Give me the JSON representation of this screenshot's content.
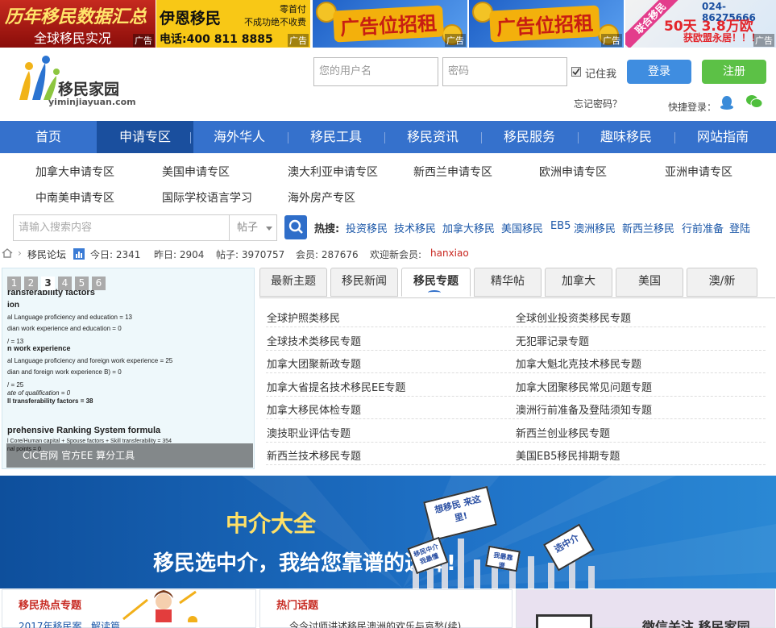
{
  "ads": [
    {
      "line1": "历年移民数据汇总",
      "line2": "全球移民实况",
      "tag": "广告"
    },
    {
      "line1": "伊恩移民",
      "line2": "零首付",
      "line3": "不成功绝不收费",
      "line4": "电话:400 811 8885",
      "tag": "广告"
    },
    {
      "line1": "广告位招租",
      "tag": "广告"
    },
    {
      "line1": "广告位招租",
      "tag": "广告"
    },
    {
      "ribbon": "联合移民",
      "line1": "024-86275666",
      "line2": "50天 3.8万欧",
      "line3": "获欧盟永居！！！",
      "tag": "广告"
    }
  ],
  "logo": {
    "name": "移民家园",
    "domain": "yiminjiayuan.com"
  },
  "login": {
    "username_placeholder": "您的用户名",
    "password_placeholder": "密码",
    "remember_label": "记住我",
    "login_button": "登录",
    "register_button": "注册",
    "forgot_link": "忘记密码？",
    "quick_login_label": "快捷登录："
  },
  "nav": [
    "首页",
    "申请专区",
    "海外华人",
    "移民工具",
    "移民资讯",
    "移民服务",
    "趣味移民",
    "网站指南"
  ],
  "subnav": [
    "加拿大申请专区",
    "美国申请专区",
    "澳大利亚申请专区",
    "新西兰申请专区",
    "欧洲申请专区",
    "亚洲申请专区",
    "中南美申请专区",
    "国际学校语言学习",
    "海外房产专区"
  ],
  "search": {
    "placeholder": "请输入搜索内容",
    "type": "帖子",
    "hot_label": "热搜:",
    "hot_links": [
      "投资移民",
      "技术移民",
      "加拿大移民",
      "美国移民",
      "EB5",
      "澳洲移民",
      "新西兰移民",
      "行前准备",
      "登陆"
    ]
  },
  "stats": {
    "forum": "移民论坛",
    "today": "今日: 2341",
    "yesterday": "昨日: 2904",
    "posts": "帖子: 3970757",
    "members": "会员: 287676",
    "welcome": "欢迎新会员:",
    "new_member": "hanxiao"
  },
  "carousel": {
    "pages": [
      "1",
      "2",
      "3",
      "4",
      "5",
      "6"
    ],
    "active_page": 3,
    "caption": "CIC官网 官方EE 算分工具",
    "lines": [
      "ransferability factors",
      "ion",
      "al Language proficiency and education = 13",
      "dian work experience and education = 0",
      "/ = 13",
      "n work experience",
      "al Language proficiency and foreign work experience = 25",
      "dian and foreign work experience B) = 0",
      "/ = 25",
      "ate of qualification = 0",
      "ll transferability factors = 38",
      "prehensive Ranking System formula",
      "l Core/Human capital + Spouse factors + Skill transferability = 354",
      "nal points = 0"
    ]
  },
  "tabs": [
    "最新主题",
    "移民新闻",
    "移民专题",
    "精华帖",
    "加拿大",
    "美国",
    "澳/新"
  ],
  "topics_left": [
    "全球护照类移民",
    "全球技术类移民专题",
    "加拿大团聚新政专题",
    "加拿大省提名技术移民EE专题",
    "加拿大移民体检专题",
    "澳技职业评估专题",
    "新西兰技术移民专题"
  ],
  "topics_right": [
    "全球创业投资类移民专题",
    "无犯罪记录专题",
    "加拿大魁北克技术移民专题",
    "加拿大团聚移民常见问题专题",
    "澳洲行前准备及登陆须知专题",
    "新西兰创业移民专题",
    "美国EB5移民排期专题"
  ],
  "banner": {
    "title": "中介大全",
    "subtitle": "移民选中介，我给您靠谱的选择!",
    "signs": [
      "想移民 来这里!",
      "选中介",
      "移民中介 我最懂",
      "我最靠谱"
    ]
  },
  "bottom": {
    "hot_topics": "移民热点专题",
    "hot_topics_item": "2017年移民案...解读篇",
    "hot_discussion": "热门话题",
    "hot_discussion_item": "今今讨师讲述移民澳洲的欢乐与哀愁(续)",
    "wechat": "微信关注 移民家园"
  }
}
